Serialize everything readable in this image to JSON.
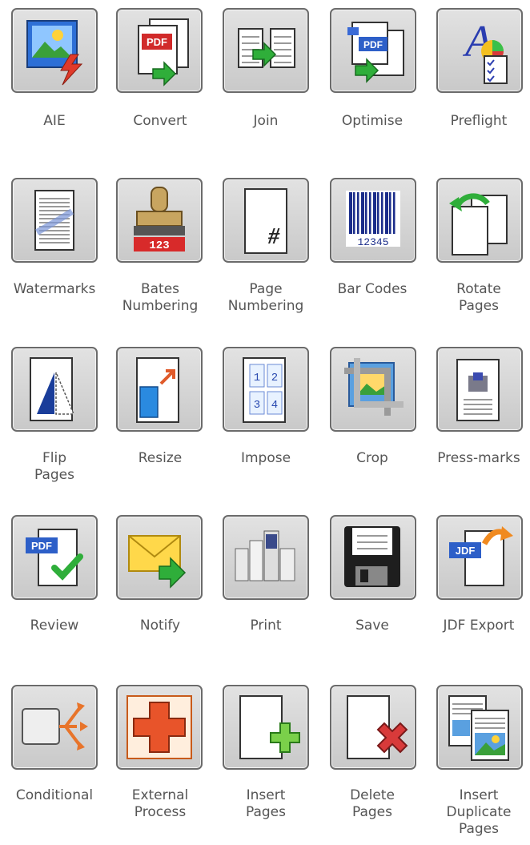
{
  "tools": [
    {
      "id": "aie",
      "label": "AIE",
      "icon": "image-lightning-icon"
    },
    {
      "id": "convert",
      "label": "Convert",
      "icon": "pdf-convert-icon"
    },
    {
      "id": "join",
      "label": "Join",
      "icon": "join-documents-icon"
    },
    {
      "id": "optimise",
      "label": "Optimise",
      "icon": "pdf-optimise-icon"
    },
    {
      "id": "preflight",
      "label": "Preflight",
      "icon": "preflight-checklist-icon"
    },
    {
      "id": "watermarks",
      "label": "Watermarks",
      "icon": "watermark-document-icon"
    },
    {
      "id": "bates",
      "label": "Bates\nNumbering",
      "icon": "stamp-icon"
    },
    {
      "id": "page-numbering",
      "label": "Page\nNumbering",
      "icon": "hash-page-icon"
    },
    {
      "id": "bar-codes",
      "label": "Bar Codes",
      "icon": "barcode-icon"
    },
    {
      "id": "rotate",
      "label": "Rotate\nPages",
      "icon": "rotate-page-icon"
    },
    {
      "id": "flip",
      "label": "Flip\nPages",
      "icon": "flip-page-icon"
    },
    {
      "id": "resize",
      "label": "Resize",
      "icon": "resize-page-icon"
    },
    {
      "id": "impose",
      "label": "Impose",
      "icon": "impose-grid-icon"
    },
    {
      "id": "crop",
      "label": "Crop",
      "icon": "crop-icon"
    },
    {
      "id": "press-marks",
      "label": "Press-marks",
      "icon": "press-marks-icon"
    },
    {
      "id": "review",
      "label": "Review",
      "icon": "pdf-review-check-icon"
    },
    {
      "id": "notify",
      "label": "Notify",
      "icon": "envelope-arrow-icon"
    },
    {
      "id": "print",
      "label": "Print",
      "icon": "printer-icon"
    },
    {
      "id": "save",
      "label": "Save",
      "icon": "floppy-disk-icon"
    },
    {
      "id": "jdf-export",
      "label": "JDF Export",
      "icon": "jdf-export-icon"
    },
    {
      "id": "conditional",
      "label": "Conditional",
      "icon": "conditional-branch-icon"
    },
    {
      "id": "external-process",
      "label": "External\nProcess",
      "icon": "external-process-cross-icon"
    },
    {
      "id": "insert-pages",
      "label": "Insert\nPages",
      "icon": "insert-page-plus-icon"
    },
    {
      "id": "delete-pages",
      "label": "Delete\nPages",
      "icon": "delete-page-x-icon"
    },
    {
      "id": "insert-duplicate",
      "label": "Insert\nDuplicate\nPages",
      "icon": "duplicate-pages-icon"
    }
  ]
}
